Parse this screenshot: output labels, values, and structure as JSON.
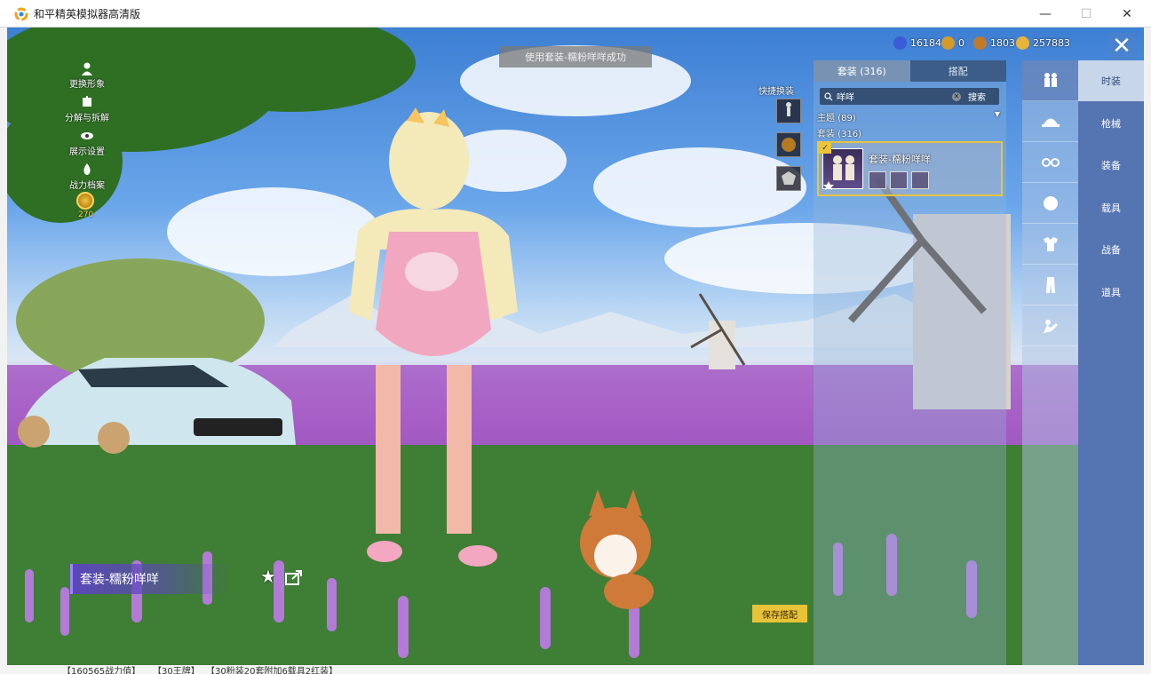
{
  "window": {
    "title": "和平精英模拟器高清版",
    "buttons": {
      "minimize": "—",
      "maximize": "☐",
      "close": "✕"
    }
  },
  "background_window": {
    "bottom_text": [
      "【160565战力值】",
      "【30王牌】",
      "【30粉装20套附加6载具2红装】"
    ]
  },
  "menu": {
    "items": [
      {
        "label": "更换形象",
        "icon": "person-icon"
      },
      {
        "label": "分解与拆解",
        "icon": "puzzle-icon"
      },
      {
        "label": "展示设置",
        "icon": "eye-icon"
      },
      {
        "label": "战力档案",
        "icon": "flame-icon"
      }
    ],
    "level": "270"
  },
  "toast": "使用套装-糯粉咩咩成功",
  "currencies": [
    {
      "value": "16184",
      "color": "#3b5bd6"
    },
    {
      "value": "0",
      "color": "#d49a2a"
    },
    {
      "value": "1803",
      "color": "#c07a2b"
    },
    {
      "value": "257883",
      "color": "#e8b437"
    }
  ],
  "quick_swap": {
    "label": "快捷换装"
  },
  "panel": {
    "tabs": [
      {
        "label": "套装 (316)",
        "active": true
      },
      {
        "label": "搭配",
        "active": false
      }
    ],
    "search": {
      "value": "咩咩",
      "button": "搜索",
      "clear": "✕"
    },
    "theme": {
      "label": "主题 (89)"
    },
    "suit_count": "套装 (316)",
    "card": {
      "name": "套装-糯粉咩咩",
      "check": "✓"
    }
  },
  "rail": {
    "items": [
      "outfit-icon",
      "hat-icon",
      "glasses-icon",
      "face-icon",
      "top-icon",
      "pants-icon",
      "emote-icon"
    ]
  },
  "nav": {
    "items": [
      {
        "label": "时装",
        "active": true
      },
      {
        "label": "枪械",
        "active": false
      },
      {
        "label": "装备",
        "active": false
      },
      {
        "label": "载具",
        "active": false
      },
      {
        "label": "战备",
        "active": false
      },
      {
        "label": "道具",
        "active": false
      }
    ]
  },
  "suit_title": "套装-糯粉咩咩",
  "star": "★",
  "save_button": "保存搭配",
  "colors": {
    "accent_gold": "#e8c238",
    "nav_blue": "#5575b2",
    "suit_purple": "#5b47b8"
  }
}
